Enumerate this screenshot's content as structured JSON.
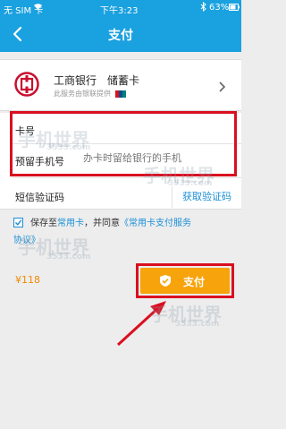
{
  "status_bar": {
    "carrier": "无 SIM 卡",
    "time": "下午3:23",
    "battery": "63%"
  },
  "nav": {
    "title": "支付"
  },
  "card": {
    "bank_name": "工商银行　储蓄卡",
    "provider_note": "此服务由银联提供"
  },
  "form": {
    "card_label": "卡号",
    "phone_label": "预留手机号",
    "phone_placeholder": "办卡时留给银行的手机",
    "sms_label": "短信验证码",
    "get_code_label": "获取验证码"
  },
  "agreement": {
    "prefix": "保存至",
    "link1": "常用卡",
    "middle": "，并同意",
    "link2": "《常用卡支付服务",
    "line2": "协议》"
  },
  "payment": {
    "amount": "¥118",
    "pay_label": "支付"
  },
  "watermark": {
    "text": "手机世界",
    "sub": "3533.com"
  },
  "colors": {
    "header": "#1aa1e0",
    "link": "#1a8fd6",
    "pay_button": "#f7a30c",
    "annotation": "#d90f20"
  }
}
